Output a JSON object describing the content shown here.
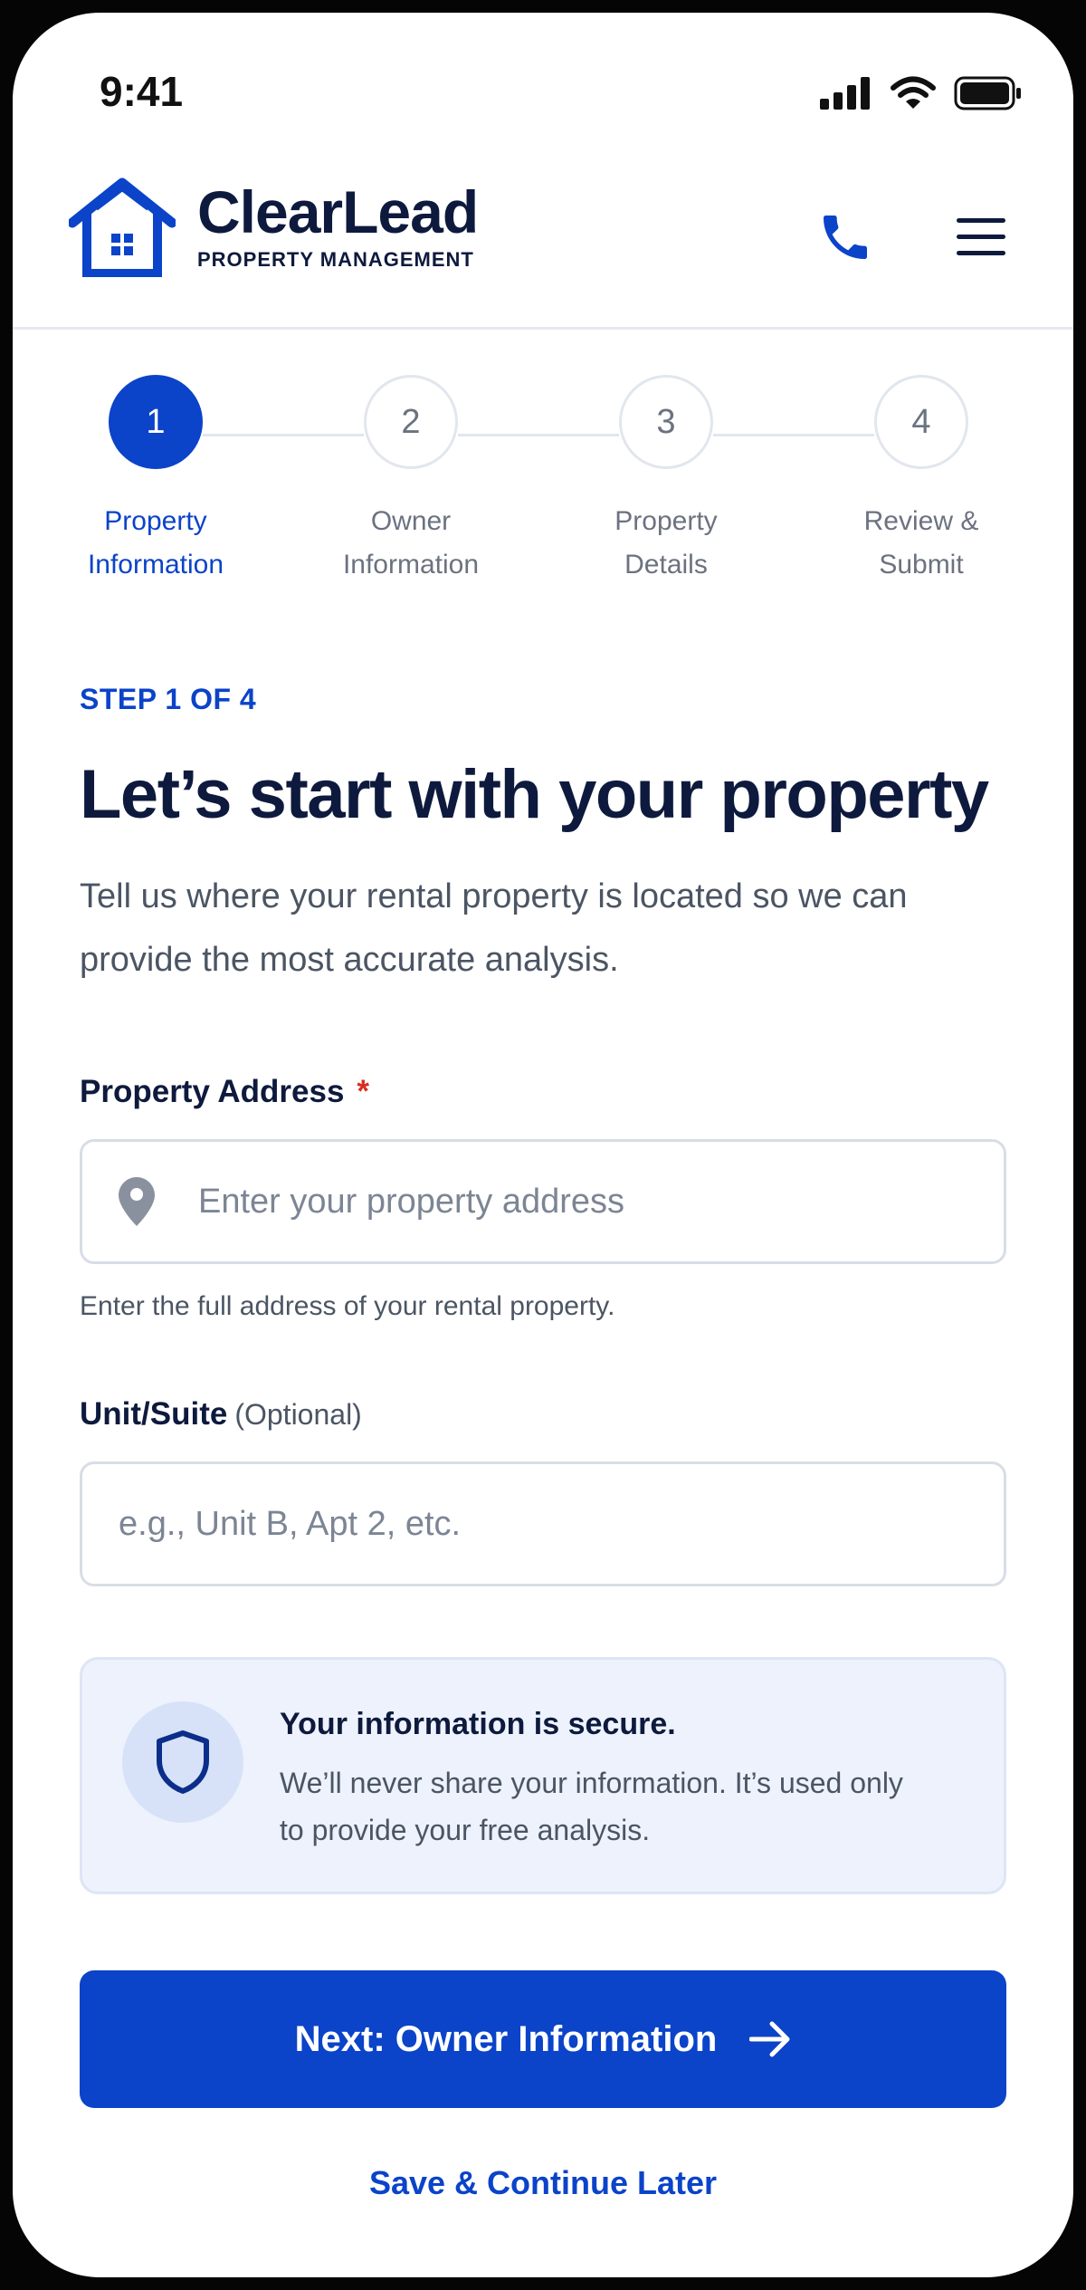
{
  "status_bar": {
    "time": "9:41"
  },
  "header": {
    "brand_name": "ClearLead",
    "brand_tagline": "PROPERTY MANAGEMENT",
    "icons": {
      "logo": "house-logo-icon",
      "call": "phone-icon",
      "menu": "hamburger-menu-icon"
    }
  },
  "stepper": {
    "steps": [
      {
        "number": "1",
        "label_line1": "Property",
        "label_line2": "Information",
        "state": "active"
      },
      {
        "number": "2",
        "label_line1": "Owner",
        "label_line2": "Information",
        "state": "upcoming"
      },
      {
        "number": "3",
        "label_line1": "Property",
        "label_line2": "Details",
        "state": "upcoming"
      },
      {
        "number": "4",
        "label_line1": "Review &",
        "label_line2": "Submit",
        "state": "upcoming"
      }
    ]
  },
  "form": {
    "step_indicator": "STEP 1 OF 4",
    "title": "Let’s start with your property",
    "description": "Tell us where your rental property is located so we can provide the most accurate analysis.",
    "address": {
      "label": "Property Address",
      "required_mark": "*",
      "value": "",
      "placeholder": "Enter your property address",
      "helper": "Enter the full address of your rental property."
    },
    "unit": {
      "label": "Unit/Suite",
      "optional_note": "(Optional)",
      "value": "",
      "placeholder": "e.g., Unit B, Apt 2, etc."
    },
    "secure_notice": {
      "title": "Your information is secure.",
      "text": "We’ll never share your information. It’s used only to provide your free analysis."
    },
    "next_button": "Next: Owner Information",
    "save_link": "Save & Continue Later"
  },
  "colors": {
    "primary": "#0b43c9",
    "heading": "#0e1a3d",
    "body_text": "#4b5563",
    "border": "#d8dde6",
    "notice_bg": "#edf2fc",
    "required": "#d92d20"
  }
}
